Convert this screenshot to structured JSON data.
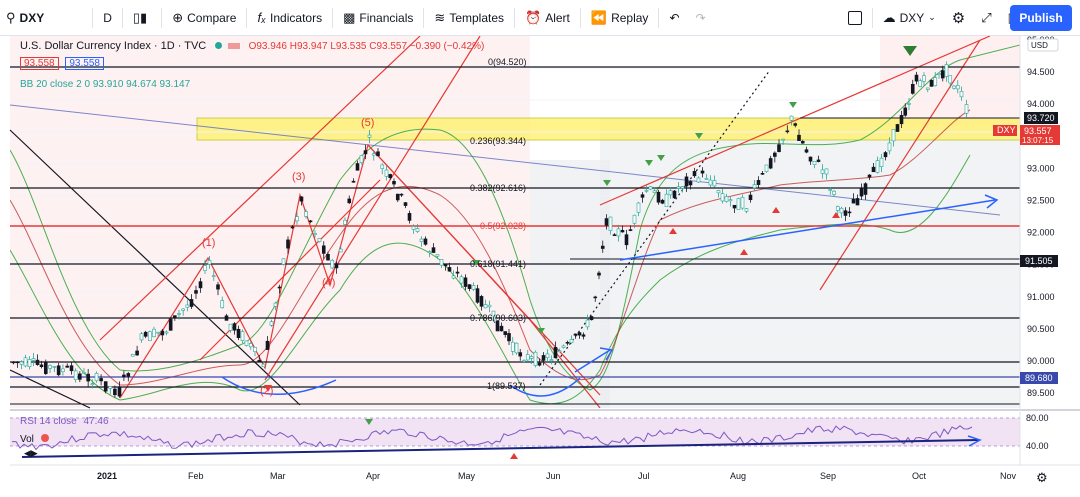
{
  "toolbar": {
    "symbol": "DXY",
    "interval": "D",
    "compare": "Compare",
    "indicators": "Indicators",
    "financials": "Financials",
    "templates": "Templates",
    "alert": "Alert",
    "replay": "Replay",
    "symbol_right": "DXY",
    "publish": "Publish"
  },
  "legend": {
    "title": "U.S. Dollar Currency Index · 1D · TVC",
    "ohlc": "O93.946 H93.947 L93.535 C93.557 −0.390 (−0.42%)",
    "price_left": "93.558",
    "price_right": "93.558",
    "bb": "BB 20 close 2 0  93.910  94.674  93.147"
  },
  "price_axis": {
    "currency": "USD",
    "ticks": [
      "95.000",
      "94.500",
      "94.000",
      "93.500",
      "93.000",
      "92.500",
      "92.000",
      "91.500",
      "91.000",
      "90.500",
      "90.000",
      "89.500"
    ],
    "badges": [
      {
        "text": "93.720",
        "color": "#131722"
      },
      {
        "text": "DXY",
        "color": "#e53935"
      },
      {
        "text": "93.557",
        "color": "#e53935"
      },
      {
        "text": "13:07:15",
        "color": "#e53935"
      },
      {
        "text": "91.505",
        "color": "#131722"
      },
      {
        "text": "89.680",
        "color": "#3949ab"
      }
    ]
  },
  "fib": [
    {
      "label": "0(94.520)"
    },
    {
      "label": "0.236(93.344)"
    },
    {
      "label": "0.382(92.616)"
    },
    {
      "label": "0.5(92.028)"
    },
    {
      "label": "0.618(91.441)"
    },
    {
      "label": "0.786(90.603)"
    },
    {
      "label": "1(89.537)"
    }
  ],
  "waves": [
    "(1)",
    "(2)",
    "(3)",
    "(4)",
    "(5)"
  ],
  "rsi": {
    "label": "RSI 14 close",
    "value": "47.46",
    "ticks": [
      "80.00",
      "40.00"
    ]
  },
  "vol_label": "Vol",
  "time_axis": [
    "2021",
    "Feb",
    "Mar",
    "Apr",
    "May",
    "Jun",
    "Jul",
    "Aug",
    "Sep",
    "Oct",
    "Nov"
  ],
  "colors": {
    "accent": "#2962ff",
    "up": "#26a69a",
    "down": "#e53935",
    "zone": "#ffeb3b"
  }
}
